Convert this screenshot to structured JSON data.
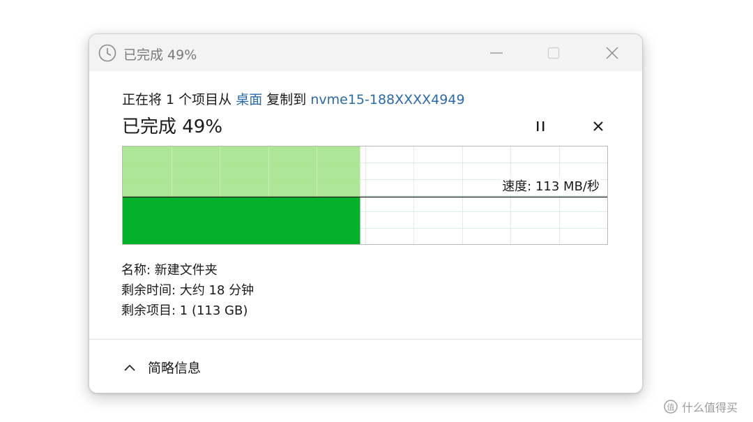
{
  "window": {
    "title": "已完成 49%"
  },
  "header": {
    "prefix": "正在将 1 个项目从",
    "source": "桌面",
    "middle": "复制到",
    "destination": "nvme15-188XXXX4949",
    "percent_text": "已完成 49%"
  },
  "progress": {
    "percent": 49
  },
  "graph": {
    "speed_label": "速度: 113 MB/秒"
  },
  "details": {
    "name": "名称: 新建文件夹",
    "time_remaining": "剩余时间: 大约 18 分钟",
    "items_remaining": "剩余项目: 1 (113 GB)"
  },
  "footer": {
    "toggle_label": "简略信息"
  },
  "watermark": {
    "text": "什么值得买"
  },
  "colors": {
    "progress_dark": "#05b02a",
    "progress_light": "#a6e48d",
    "grid": "#dcefe1",
    "link": "#2d6aa8"
  },
  "icons": {
    "title": "clock-icon",
    "minimize": "minimize-icon",
    "maximize": "maximize-icon",
    "close": "close-icon",
    "pause": "pause-icon",
    "cancel": "cancel-icon",
    "toggle": "chevron-up-icon"
  }
}
